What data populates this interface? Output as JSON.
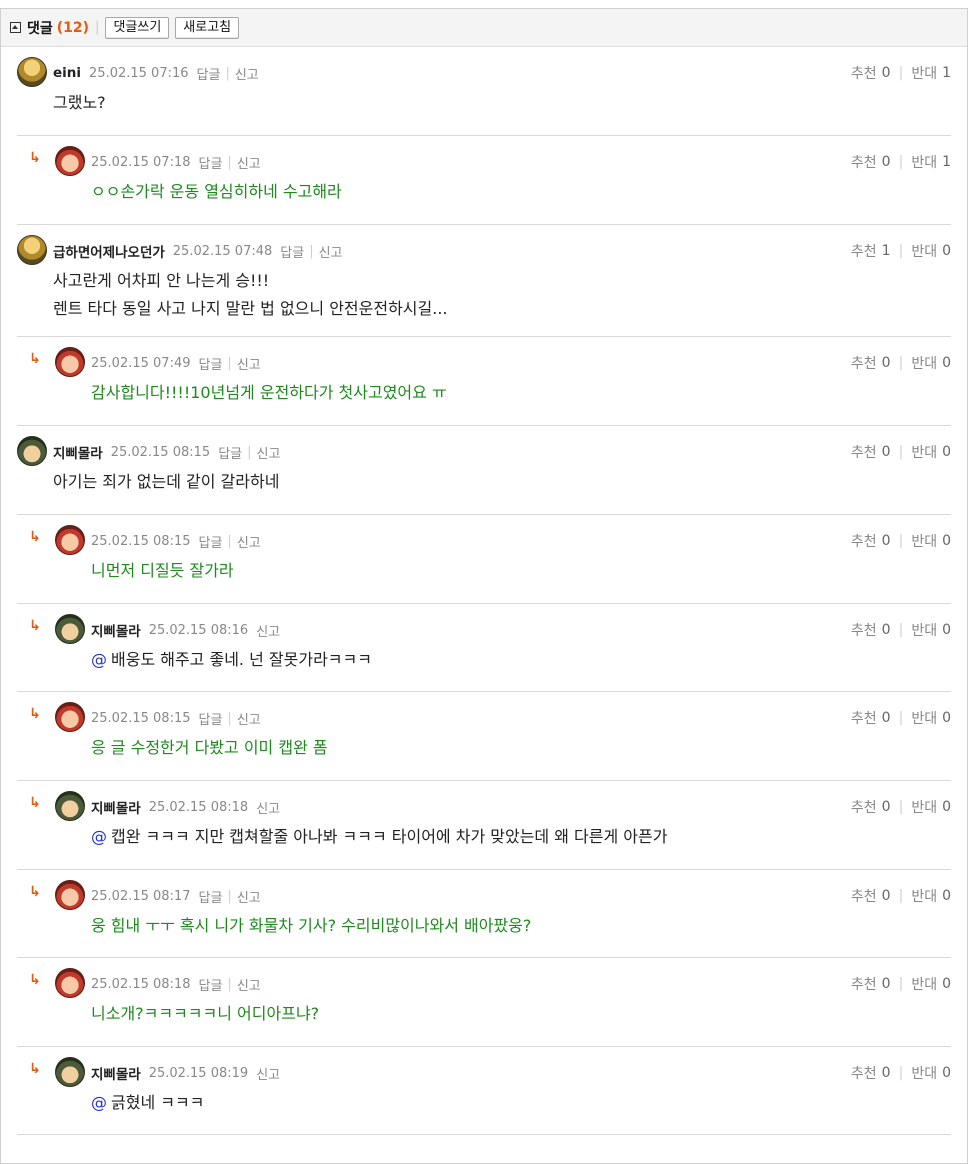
{
  "header": {
    "title": "댓글",
    "count": "(12)",
    "write_button": "댓글쓰기",
    "refresh_button": "새로고침"
  },
  "labels": {
    "reply": "답글",
    "report": "신고",
    "recommend": "추천",
    "oppose": "반대"
  },
  "comments": [
    {
      "nick": "eini",
      "time": "25.02.15 07:16",
      "has_reply": true,
      "lines": [
        "그랬노?"
      ],
      "up": "0",
      "down": "1"
    },
    {
      "nick": "",
      "time": "25.02.15 07:18",
      "has_reply": true,
      "lines": [
        "ㅇㅇ손가락 운동 열심히하네 수고해라"
      ],
      "up": "0",
      "down": "1"
    },
    {
      "nick": "급하면어제나오던가",
      "time": "25.02.15 07:48",
      "has_reply": true,
      "lines": [
        "사고란게 어차피 안 나는게 승!!!",
        "렌트 타다 동일 사고 나지 말란 법 없으니 안전운전하시길..."
      ],
      "up": "1",
      "down": "0"
    },
    {
      "nick": "",
      "time": "25.02.15 07:49",
      "has_reply": true,
      "lines": [
        "감사합니다!!!!10년넘게 운전하다가 첫사고였어요 ㅠ"
      ],
      "up": "0",
      "down": "0"
    },
    {
      "nick": "지삐몰라",
      "time": "25.02.15 08:15",
      "has_reply": true,
      "lines": [
        "아기는 죄가 없는데 같이 갈라하네"
      ],
      "up": "0",
      "down": "0"
    },
    {
      "nick": "",
      "time": "25.02.15 08:15",
      "has_reply": true,
      "lines": [
        "니먼저 디질듯 잘가라"
      ],
      "up": "0",
      "down": "0"
    },
    {
      "nick": "지삐몰라",
      "time": "25.02.15 08:16",
      "has_reply": false,
      "mention": "@",
      "lines": [
        "배웅도 해주고 좋네. 넌 잘못가라ㅋㅋㅋ"
      ],
      "up": "0",
      "down": "0"
    },
    {
      "nick": "",
      "time": "25.02.15 08:15",
      "has_reply": true,
      "lines": [
        "응 글 수정한거 다봤고 이미 캡완 폼"
      ],
      "up": "0",
      "down": "0"
    },
    {
      "nick": "지삐몰라",
      "time": "25.02.15 08:18",
      "has_reply": false,
      "mention": "@",
      "lines": [
        "캡완 ㅋㅋㅋ 지만 캡쳐할줄 아나봐 ㅋㅋㅋ 타이어에 차가 맞았는데 왜 다른게 아픈가"
      ],
      "up": "0",
      "down": "0"
    },
    {
      "nick": "",
      "time": "25.02.15 08:17",
      "has_reply": true,
      "lines": [
        "웅 힘내 ㅜㅜ 혹시 니가 화물차 기사? 수리비많이나와서 배아팠웅?"
      ],
      "up": "0",
      "down": "0"
    },
    {
      "nick": "",
      "time": "25.02.15 08:18",
      "has_reply": true,
      "lines": [
        "니소개?ㅋㅋㅋㅋㅋ니 어디아프냐?"
      ],
      "up": "0",
      "down": "0"
    },
    {
      "nick": "지삐몰라",
      "time": "25.02.15 08:19",
      "has_reply": false,
      "mention": "@",
      "lines": [
        "긁혔네 ㅋㅋㅋ"
      ],
      "up": "0",
      "down": "0"
    }
  ]
}
